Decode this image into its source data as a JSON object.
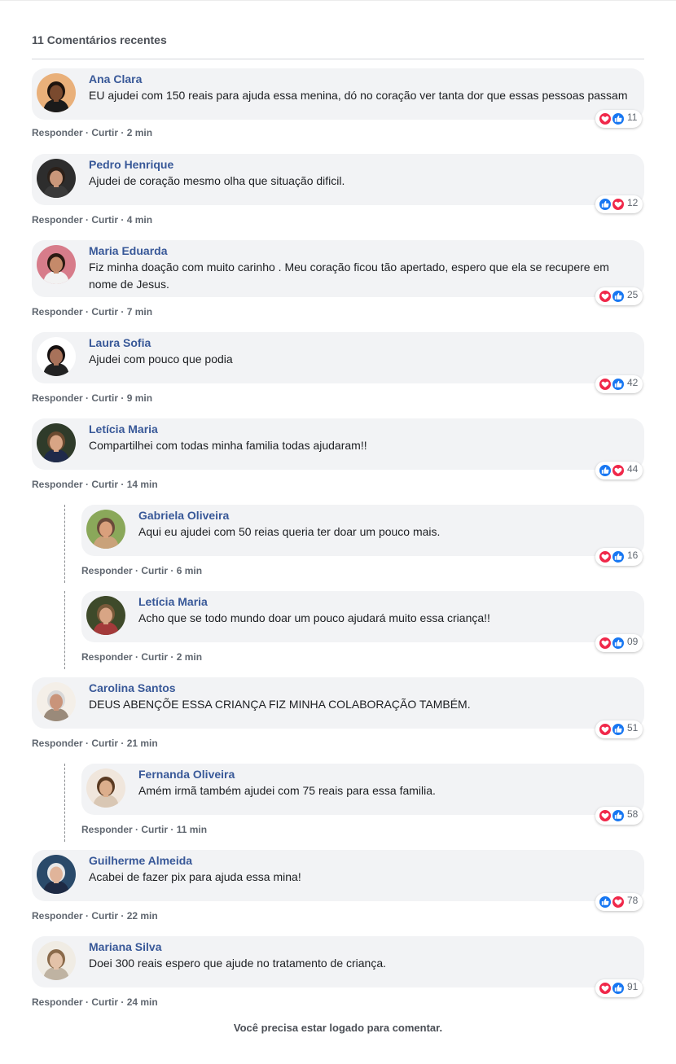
{
  "header": {
    "title": "11 Comentários recentes"
  },
  "action_labels": {
    "reply": "Responder",
    "like": "Curtir",
    "sep": " · "
  },
  "comments": [
    {
      "name": "Ana Clara",
      "text": "EU ajudei com 150 reais para ajuda essa menina, dó no coração ver tanta dor que essas pessoas passam",
      "time": "2 min",
      "reactions": [
        "love",
        "like"
      ],
      "count": "11"
    },
    {
      "name": "Pedro Henrique",
      "text": "Ajudei de coração mesmo olha que situação dificil.",
      "time": "4 min",
      "reactions": [
        "like",
        "love"
      ],
      "count": "12"
    },
    {
      "name": "Maria Eduarda",
      "text": "Fiz minha doação com muito carinho . Meu coração ficou tão apertado, espero que ela se recupere em nome de Jesus.",
      "time": "7 min",
      "reactions": [
        "love",
        "like"
      ],
      "count": "25"
    },
    {
      "name": "Laura Sofia",
      "text": "Ajudei com pouco que podia",
      "time": "9 min",
      "reactions": [
        "love",
        "like"
      ],
      "count": "42"
    },
    {
      "name": "Letícia Maria",
      "text": "Compartilhei com todas minha familia todas ajudaram!!",
      "time": "14 min",
      "reactions": [
        "like",
        "love"
      ],
      "count": "44"
    },
    {
      "name": "Gabriela Oliveira",
      "text": "Aqui eu ajudei com 50 reias queria ter doar um pouco mais.",
      "time": "6 min",
      "reactions": [
        "love",
        "like"
      ],
      "count": "16"
    },
    {
      "name": "Letícia Maria",
      "text": "Acho que se todo mundo doar um pouco ajudará muito essa criança!!",
      "time": "2 min",
      "reactions": [
        "love",
        "like"
      ],
      "count": "09"
    },
    {
      "name": "Carolina Santos",
      "text": "DEUS ABENÇÕE ESSA CRIANÇA FIZ MINHA COLABORAÇÃO TAMBÉM.",
      "time": "21 min",
      "reactions": [
        "love",
        "like"
      ],
      "count": "51"
    },
    {
      "name": "Fernanda Oliveira",
      "text": "Amém irmã também ajudei com 75 reais para essa familia.",
      "time": "11 min",
      "reactions": [
        "love",
        "like"
      ],
      "count": "58"
    },
    {
      "name": "Guilherme Almeida",
      "text": "Acabei de fazer pix para ajuda essa mina!",
      "time": "22 min",
      "reactions": [
        "like",
        "love"
      ],
      "count": "78"
    },
    {
      "name": "Mariana Silva",
      "text": "Doei 300 reais espero que ajude no tratamento de criança.",
      "time": "24 min",
      "reactions": [
        "love",
        "like"
      ],
      "count": "91"
    }
  ],
  "footer": {
    "text": "Você precisa estar logado para comentar."
  },
  "colors": {
    "name": "#385898",
    "bubble": "#f2f3f5",
    "love": "#f0284a",
    "like": "#1877f2"
  },
  "avatars": [
    {
      "skin": "#7a4a2e",
      "hair": "#1e140e",
      "bg": "#e9b07a",
      "shirt": "#1a1a1a"
    },
    {
      "skin": "#c9977a",
      "hair": "#2b2019",
      "bg": "#2d2d2d",
      "shirt": "#3a3a3a"
    },
    {
      "skin": "#c58a6a",
      "hair": "#2a1a12",
      "bg": "#d77c8a",
      "shirt": "#f2f2f2"
    },
    {
      "skin": "#a8725a",
      "hair": "#151010",
      "bg": "#ffffff",
      "shirt": "#222222"
    },
    {
      "skin": "#d8a585",
      "hair": "#6b4a30",
      "bg": "#2f3b2a",
      "shirt": "#1f2a4a"
    },
    {
      "skin": "#d9a07c",
      "hair": "#6a4a3a",
      "bg": "#8aa85a",
      "shirt": "#c9a27a"
    },
    {
      "skin": "#d8a585",
      "hair": "#7a5a3a",
      "bg": "#3e4a2a",
      "shirt": "#a33a3a"
    },
    {
      "skin": "#c9947a",
      "hair": "#d8d8d8",
      "bg": "#f4efe8",
      "shirt": "#9a8a7a"
    },
    {
      "skin": "#dcae8c",
      "hair": "#5a3a22",
      "bg": "#f0e6dc",
      "shirt": "#d9c7b4"
    },
    {
      "skin": "#e0b49a",
      "hair": "#e8e8e8",
      "bg": "#2a4a6a",
      "shirt": "#1e2a44"
    },
    {
      "skin": "#e3c2a8",
      "hair": "#8a6a4a",
      "bg": "#f0ece4",
      "shirt": "#bfb3a2"
    }
  ]
}
